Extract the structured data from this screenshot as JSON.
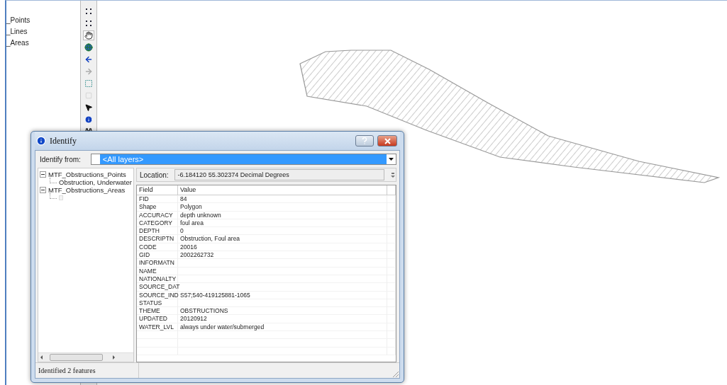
{
  "toc": {
    "items": [
      "_Points",
      "_Lines",
      "_Areas"
    ]
  },
  "dialog": {
    "title": "Identify",
    "identify_from": {
      "label": "Identify from:",
      "value": "<All layers>"
    },
    "tree": [
      {
        "label": "MTF_Obstructions_Points",
        "expanded": true,
        "children": [
          {
            "label": "Obstruction, Underwater"
          }
        ]
      },
      {
        "label": "MTF_Obstructions_Areas",
        "expanded": true,
        "children": [
          {
            "kind": "blank"
          }
        ]
      }
    ],
    "location": {
      "label": "Location:",
      "value": "-6.184120  55.302374 Decimal Degrees"
    },
    "table": {
      "columns": [
        "Field",
        "Value"
      ],
      "rows": [
        [
          "FID",
          "84"
        ],
        [
          "Shape",
          "Polygon"
        ],
        [
          "ACCURACY",
          "depth unknown"
        ],
        [
          "CATEGORY",
          "foul area"
        ],
        [
          "DEPTH",
          "0"
        ],
        [
          "DESCRIPTN",
          "Obstruction, Foul area"
        ],
        [
          "CODE",
          "20016"
        ],
        [
          "GID",
          "2002262732"
        ],
        [
          "INFORMATN",
          ""
        ],
        [
          "NAME",
          ""
        ],
        [
          "NATIONALTY",
          ""
        ],
        [
          "SOURCE_DAT",
          ""
        ],
        [
          "SOURCE_IND",
          "S57;540-419125881-1065"
        ],
        [
          "STATUS",
          ""
        ],
        [
          "THEME",
          "OBSTRUCTIONS"
        ],
        [
          "UPDATED",
          "20120912"
        ],
        [
          "WATER_LVL",
          "always under water/submerged"
        ]
      ]
    },
    "status": "Identified 2 features"
  }
}
